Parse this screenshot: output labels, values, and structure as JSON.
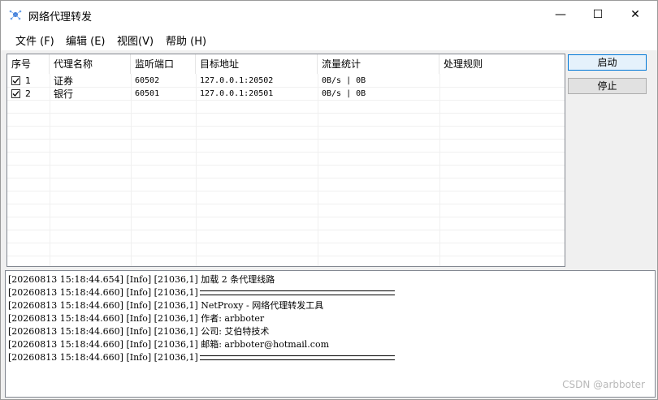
{
  "window": {
    "title": "网络代理转发",
    "minimize_glyph": "—",
    "maximize_glyph": "☐",
    "close_glyph": "✕"
  },
  "menu": {
    "items": [
      {
        "label": "文件 (F)"
      },
      {
        "label": "编辑 (E)"
      },
      {
        "label": "视图(V)"
      },
      {
        "label": "帮助 (H)"
      }
    ]
  },
  "table": {
    "headers": [
      "序号",
      "代理名称",
      "监听端口",
      "目标地址",
      "流量统计",
      "处理规则"
    ],
    "rows": [
      {
        "checked": true,
        "index": "1",
        "name": "证券",
        "port": "60502",
        "target": "127.0.0.1:20502",
        "traffic": "0B/s | 0B",
        "rule": ""
      },
      {
        "checked": true,
        "index": "2",
        "name": "银行",
        "port": "60501",
        "target": "127.0.0.1:20501",
        "traffic": "0B/s | 0B",
        "rule": ""
      }
    ]
  },
  "buttons": {
    "start": "启动",
    "stop": "停止"
  },
  "log": {
    "lines": [
      "[20260813 15:18:44.654] [Info] [21036,1] 加载 2 条代理线路",
      "[20260813 15:18:44.660] [Info] [21036,1]",
      "[20260813 15:18:44.660] [Info] [21036,1] NetProxy - 网络代理转发工具",
      "[20260813 15:18:44.660] [Info] [21036,1] 作者: arbboter",
      "[20260813 15:18:44.660] [Info] [21036,1] 公司: 艾伯特技术",
      "[20260813 15:18:44.660] [Info] [21036,1] 邮箱: arbboter@hotmail.com",
      "[20260813 15:18:44.660] [Info] [21036,1]"
    ]
  },
  "watermark": "CSDN @arbboter"
}
